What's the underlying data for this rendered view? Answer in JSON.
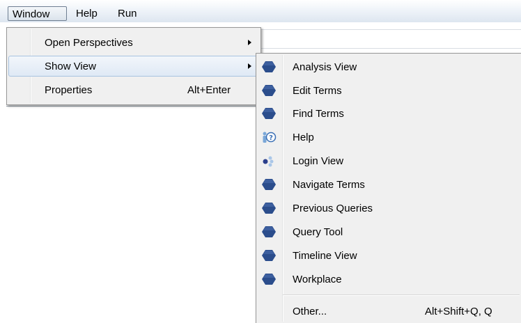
{
  "menubar": {
    "items": [
      {
        "label": "Window"
      },
      {
        "label": "Help"
      },
      {
        "label": "Run"
      }
    ]
  },
  "window_menu": {
    "items": [
      {
        "label": "Open Perspectives",
        "shortcut": "",
        "submenu": true
      },
      {
        "label": "Show View",
        "shortcut": "",
        "submenu": true
      },
      {
        "label": "Properties",
        "shortcut": "Alt+Enter",
        "submenu": false
      }
    ]
  },
  "show_view_menu": {
    "items": [
      {
        "label": "Analysis View",
        "icon": "view-hexagon-icon"
      },
      {
        "label": "Edit Terms",
        "icon": "view-hexagon-icon"
      },
      {
        "label": "Find Terms",
        "icon": "view-hexagon-icon"
      },
      {
        "label": "Help",
        "icon": "help-person-icon"
      },
      {
        "label": "Login View",
        "icon": "login-dots-icon"
      },
      {
        "label": "Navigate Terms",
        "icon": "view-hexagon-icon"
      },
      {
        "label": "Previous Queries",
        "icon": "view-hexagon-icon"
      },
      {
        "label": "Query Tool",
        "icon": "view-hexagon-icon"
      },
      {
        "label": "Timeline View",
        "icon": "view-hexagon-icon"
      },
      {
        "label": "Workplace",
        "icon": "view-hexagon-icon"
      }
    ],
    "other": {
      "label": "Other...",
      "shortcut": "Alt+Shift+Q, Q"
    }
  },
  "colors": {
    "hexagon": "#2b4d8c",
    "highlight_border": "#a8c3e0"
  }
}
